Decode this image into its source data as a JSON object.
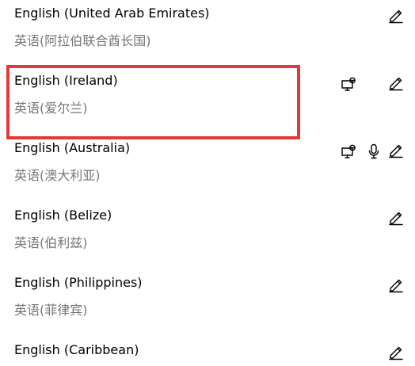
{
  "languages": [
    {
      "name": "English (United Arab Emirates)",
      "native": "英语(阿拉伯联合酋长国)",
      "features": [
        "handwriting-icon"
      ]
    },
    {
      "name": "English (Ireland)",
      "native": "英语(爱尔兰)",
      "features": [
        "display-language-icon",
        "handwriting-icon"
      ]
    },
    {
      "name": "English (Australia)",
      "native": "英语(澳大利亚)",
      "features": [
        "display-language-icon",
        "speech-microphone-icon",
        "handwriting-icon"
      ]
    },
    {
      "name": "English (Belize)",
      "native": "英语(伯利兹)",
      "features": [
        "handwriting-icon"
      ]
    },
    {
      "name": "English (Philippines)",
      "native": "英语(菲律宾)",
      "features": [
        "handwriting-icon"
      ]
    },
    {
      "name": "English (Caribbean)",
      "native": "",
      "features": [
        "handwriting-icon"
      ]
    }
  ],
  "selected_index": 1,
  "highlight_color": "#e53935",
  "secondary_text_color": "#767676"
}
